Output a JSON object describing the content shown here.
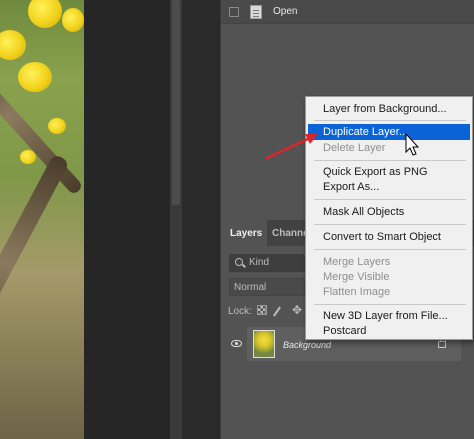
{
  "history_panel": {
    "items": [
      {
        "label": "Open"
      }
    ]
  },
  "layers_panel": {
    "tabs": [
      {
        "label": "Layers"
      },
      {
        "label": "Channe"
      }
    ],
    "filter": {
      "label": "Kind"
    },
    "blend_mode": {
      "label": "Normal"
    },
    "lock": {
      "label": "Lock:"
    },
    "layer": {
      "name": "Background"
    }
  },
  "context_menu": {
    "items": [
      {
        "label": "Layer from Background...",
        "enabled": true
      },
      {
        "label": "Duplicate Layer...",
        "enabled": true,
        "highlighted": true
      },
      {
        "label": "Delete Layer",
        "enabled": false
      },
      {
        "label": "Quick Export as PNG",
        "enabled": true
      },
      {
        "label": "Export As...",
        "enabled": true
      },
      {
        "label": "Mask All Objects",
        "enabled": true
      },
      {
        "label": "Convert to Smart Object",
        "enabled": true
      },
      {
        "label": "Merge Layers",
        "enabled": false
      },
      {
        "label": "Merge Visible",
        "enabled": false
      },
      {
        "label": "Flatten Image",
        "enabled": false
      },
      {
        "label": "New 3D Layer from File...",
        "enabled": true
      },
      {
        "label": "Postcard",
        "enabled": true
      }
    ]
  },
  "colors": {
    "menu_highlight": "#0a64d8",
    "annotation_arrow": "#d9262b",
    "panel_bg": "#535353"
  },
  "icons": {
    "history_doc": "document-icon",
    "search": "search-icon",
    "lock_pixels": "checkerboard-icon",
    "lock_paint": "brush-icon",
    "lock_move": "move-icon",
    "visibility": "eye-icon",
    "layer_lock": "lock-icon",
    "pointer": "cursor-arrow-icon"
  }
}
